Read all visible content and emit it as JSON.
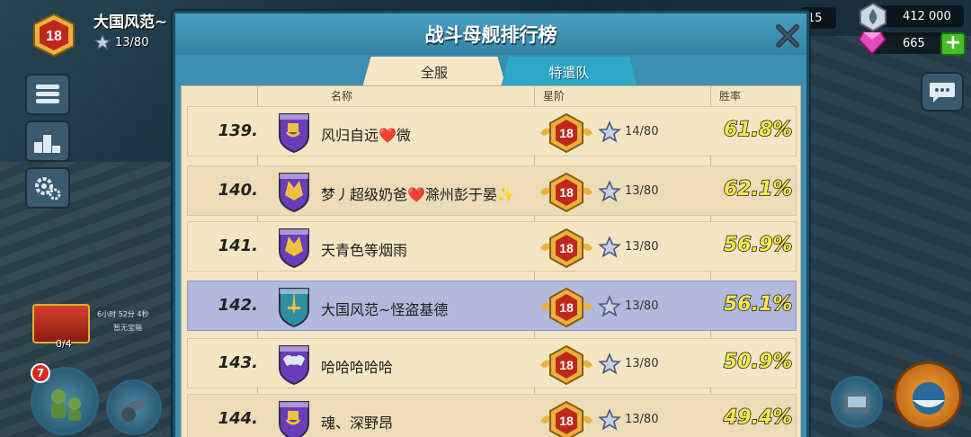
{
  "hud": {
    "player_name": "大国风范~",
    "player_level": "18",
    "player_stars": "13/80",
    "chest_timer": "6小时 52分 4秒",
    "chest_status": "暂无宝箱",
    "chest_count": "0/4",
    "troop_badge": "7"
  },
  "resources": {
    "partial_value": "15",
    "iron": "412 000",
    "gems": "665",
    "add_label": "+"
  },
  "leaderboard": {
    "title": "战斗母舰排行榜",
    "tabs": [
      "全服",
      "特遣队"
    ],
    "active_tab": 0,
    "columns": [
      "名称",
      "星阶",
      "胜率"
    ],
    "rows": [
      {
        "rank": "139.",
        "name": "风归自远❤️微",
        "level": "18",
        "stars": "14/80",
        "winrate": "61.8%",
        "emblem": "fist",
        "highlight": false
      },
      {
        "rank": "140.",
        "name": "梦丿超级奶爸❤️滁州彭于晏✨",
        "level": "18",
        "stars": "13/80",
        "winrate": "62.1%",
        "emblem": "wolf",
        "highlight": false
      },
      {
        "rank": "141.",
        "name": "天青色等烟雨",
        "level": "18",
        "stars": "13/80",
        "winrate": "56.9%",
        "emblem": "wolf",
        "highlight": false
      },
      {
        "rank": "142.",
        "name": "大国风范~怪盗基德",
        "level": "18",
        "stars": "13/80",
        "winrate": "56.1%",
        "emblem": "sword",
        "highlight": true
      },
      {
        "rank": "143.",
        "name": "哈哈哈哈哈",
        "level": "18",
        "stars": "13/80",
        "winrate": "50.9%",
        "emblem": "wings",
        "highlight": false
      },
      {
        "rank": "144.",
        "name": "魂、深野昂",
        "level": "18",
        "stars": "13/80",
        "winrate": "49.4%",
        "emblem": "fist",
        "highlight": false
      }
    ]
  },
  "colors": {
    "panel_blue": "#3c8fb0",
    "parchment": "#f4e6c4",
    "highlight_row": "#b2b9dc",
    "winrate_yellow": "#f4e84a",
    "badge_gold": "#e9b23a",
    "badge_red": "#c0271c"
  }
}
